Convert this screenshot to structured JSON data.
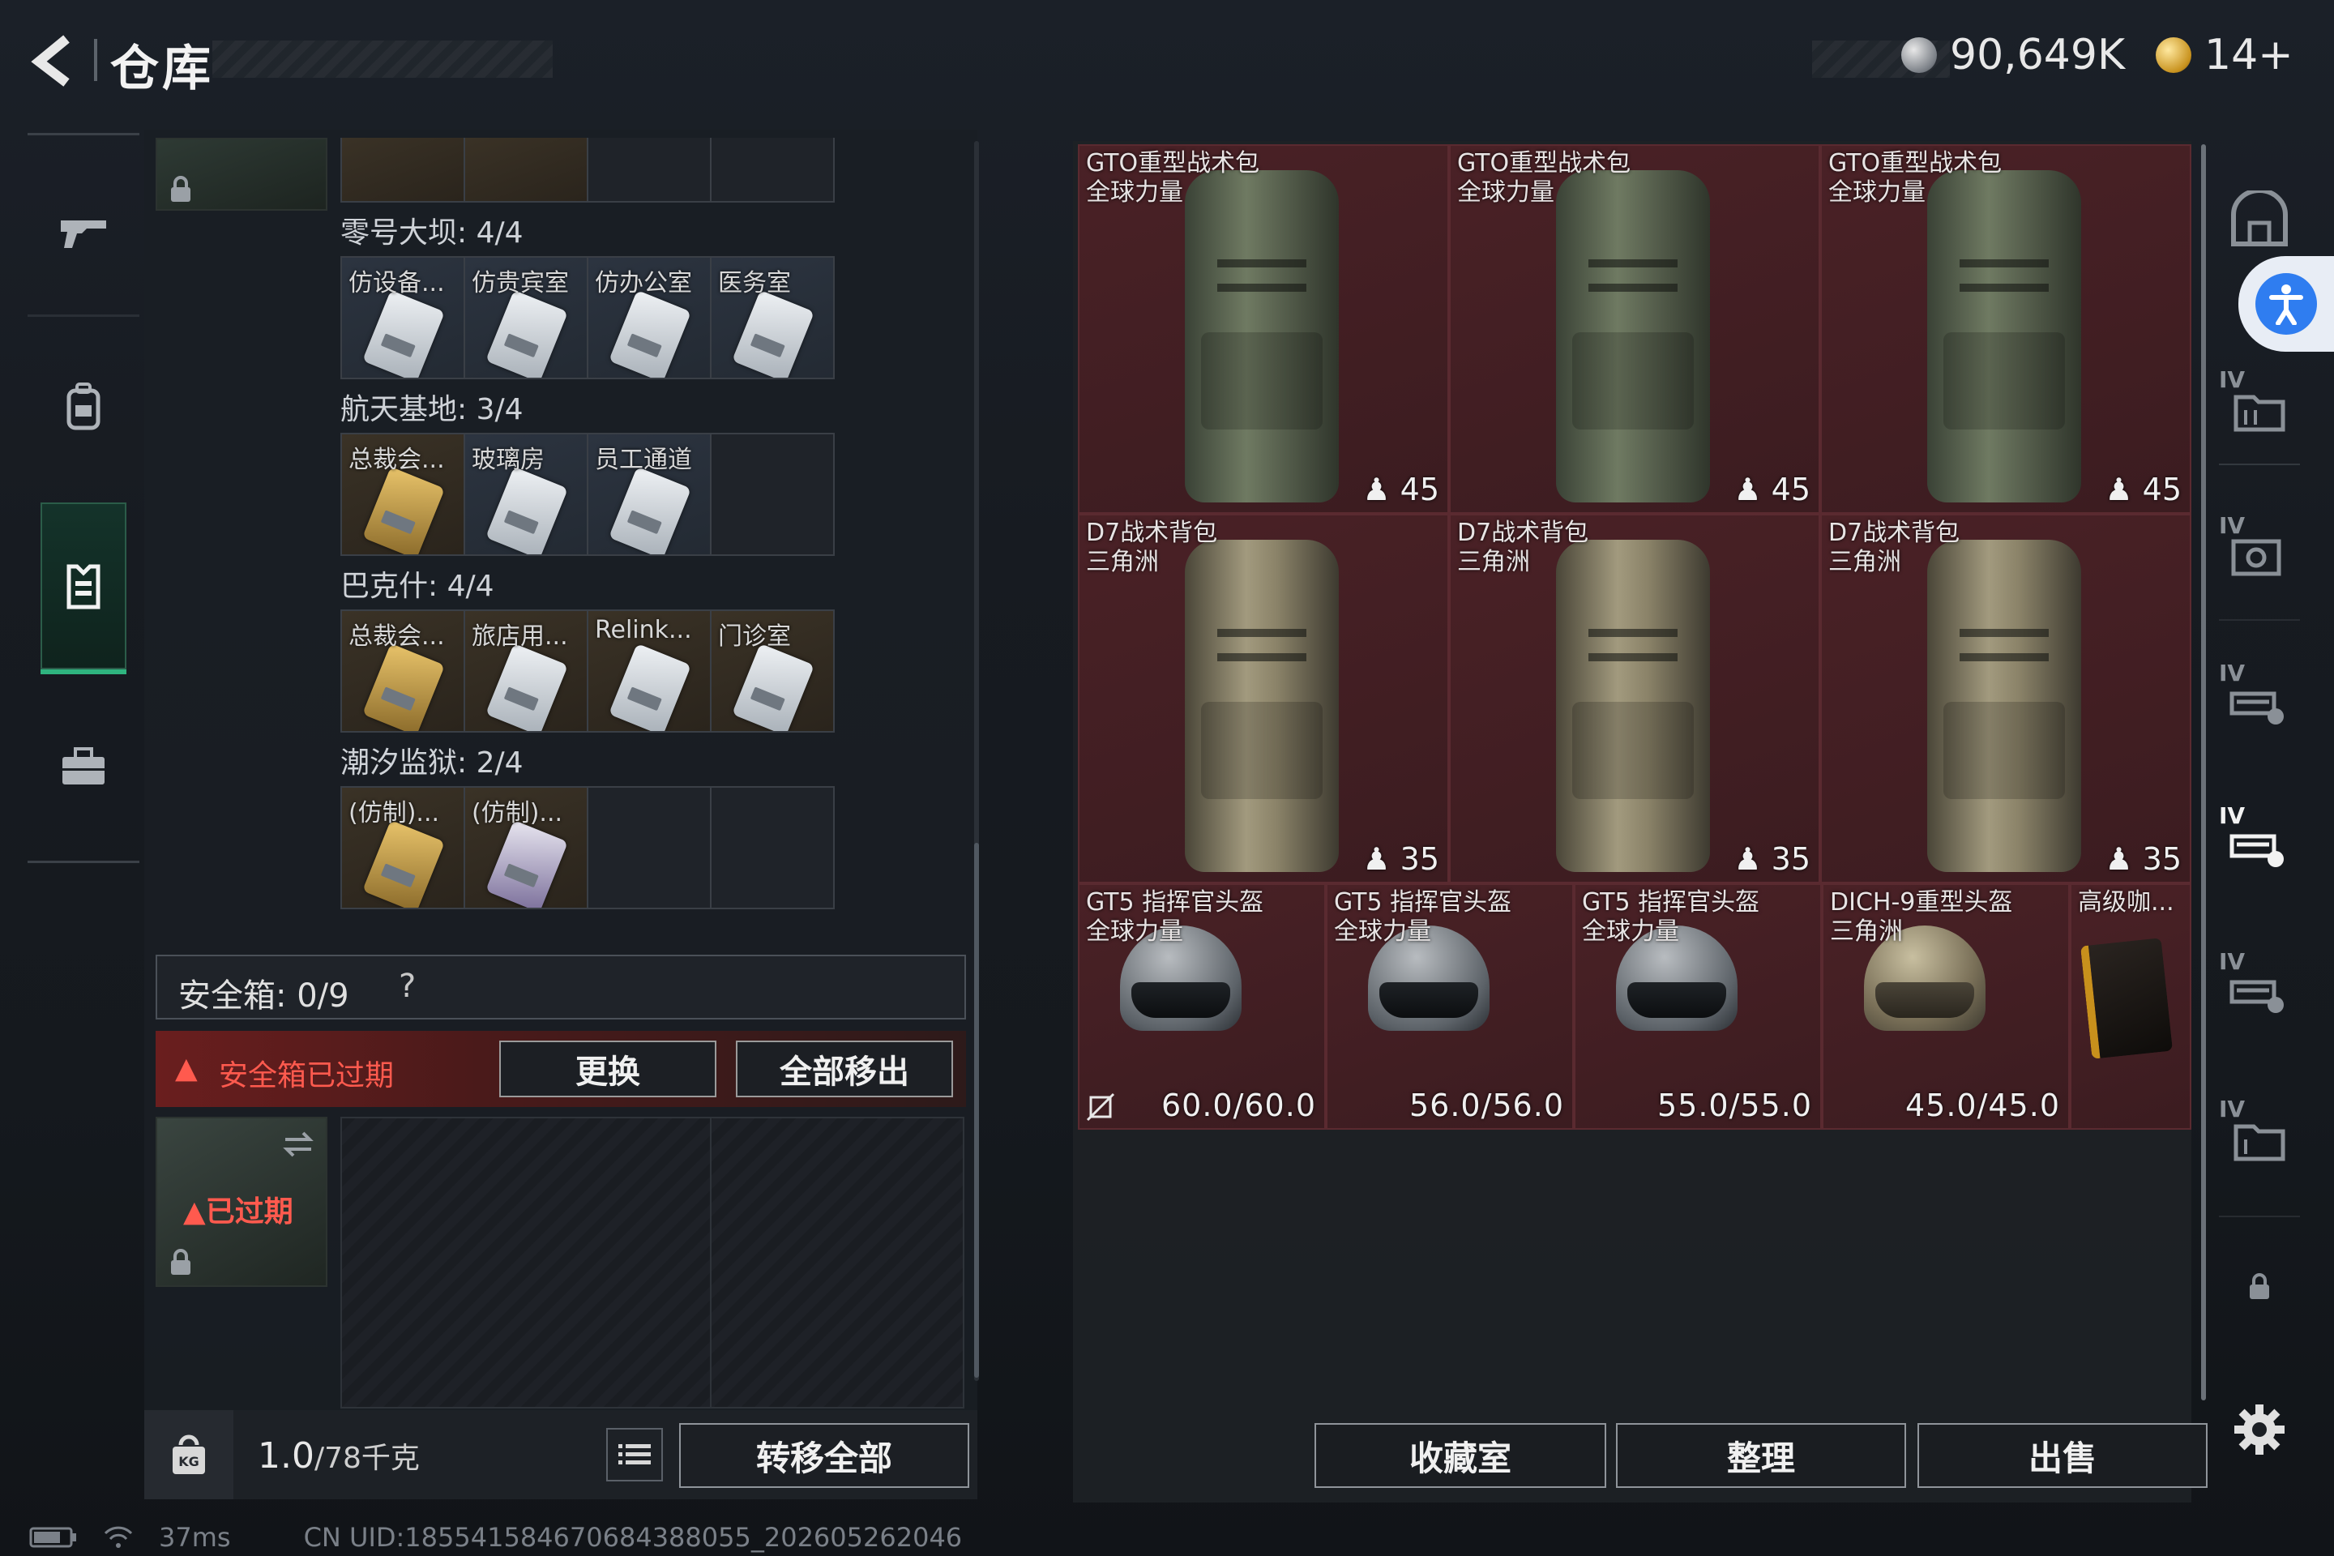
{
  "header": {
    "title": "仓库",
    "currency_1": "90,649K",
    "currency_2": "14+"
  },
  "sections": [
    {
      "label": "零号大坝: 4/4",
      "cells": [
        {
          "label": "仿设备...",
          "color": "blue"
        },
        {
          "label": "仿贵宾室",
          "color": "blue"
        },
        {
          "label": "仿办公室",
          "color": "blue"
        },
        {
          "label": "医务室",
          "color": "blue"
        }
      ]
    },
    {
      "label": "航天基地: 3/4",
      "cells": [
        {
          "label": "总裁会...",
          "color": "gold"
        },
        {
          "label": "玻璃房",
          "color": "blue"
        },
        {
          "label": "员工通道",
          "color": "blue"
        },
        {
          "label": "",
          "color": "empty"
        }
      ]
    },
    {
      "label": "巴克什: 4/4",
      "cells": [
        {
          "label": "总裁会...",
          "color": "gold"
        },
        {
          "label": "旅店用...",
          "color": "blue"
        },
        {
          "label": "Relink...",
          "color": "blue"
        },
        {
          "label": "门诊室",
          "color": "gold"
        }
      ]
    },
    {
      "label": "潮汐监狱: 2/4",
      "cells": [
        {
          "label": "(仿制)...",
          "color": "gold"
        },
        {
          "label": "(仿制)...",
          "color": "purple"
        },
        {
          "label": "",
          "color": "empty"
        },
        {
          "label": "",
          "color": "empty"
        }
      ]
    }
  ],
  "safe_box": {
    "label": "安全箱: 0/9",
    "help": "?",
    "warning": "安全箱已过期",
    "replace_btn": "更换",
    "remove_all_btn": "全部移出",
    "expired_label": "已过期"
  },
  "weight": {
    "value": "1.0",
    "max": "/78千克",
    "transfer_all_btn": "转移全部"
  },
  "stash_items": {
    "bag1_name": "GTO重型战术包",
    "bag1_sub": "全球力量",
    "bag1_cap": "45",
    "bag2_name": "GTO重型战术包",
    "bag2_sub": "全球力量",
    "bag2_cap": "45",
    "bag3_name": "GTO重型战术包",
    "bag3_sub": "全球力量",
    "bag3_cap": "45",
    "bag4_name": "D7战术背包",
    "bag4_sub": "三角洲",
    "bag4_cap": "35",
    "bag5_name": "D7战术背包",
    "bag5_sub": "三角洲",
    "bag5_cap": "35",
    "bag6_name": "D7战术背包",
    "bag6_sub": "三角洲",
    "bag6_cap": "35",
    "h1_name": "GT5 指挥官头盔",
    "h1_sub": "全球力量",
    "h1_dur": "60.0/60.0",
    "h2_name": "GT5 指挥官头盔",
    "h2_sub": "全球力量",
    "h2_dur": "56.0/56.0",
    "h3_name": "GT5 指挥官头盔",
    "h3_sub": "全球力量",
    "h3_dur": "55.0/55.0",
    "h4_name": "DICH-9重型头盔",
    "h4_sub": "三角洲",
    "h4_dur": "45.0/45.0",
    "coffee_name": "高级咖..."
  },
  "bottom_buttons": {
    "collection": "收藏室",
    "organize": "整理",
    "sell": "出售"
  },
  "right_nav_levels": [
    "IV",
    "IV",
    "IV",
    "IV",
    "IV"
  ],
  "status": {
    "ping": "37ms",
    "uid": "CN UID:1855415846706843880​55_202605262046"
  },
  "icons": {
    "back": "back-arrow-icon",
    "weapon": "gun-icon",
    "backpack": "backpack-icon",
    "vest": "vest-icon",
    "case": "briefcase-icon",
    "settings": "gear-icon",
    "lock": "lock-icon",
    "accessibility": "accessibility-icon"
  },
  "colors": {
    "item_bg": "#4a2126",
    "warning": "#ff5a4e",
    "active_nav": "#2fb47f",
    "access_blue": "#2f7df0"
  }
}
